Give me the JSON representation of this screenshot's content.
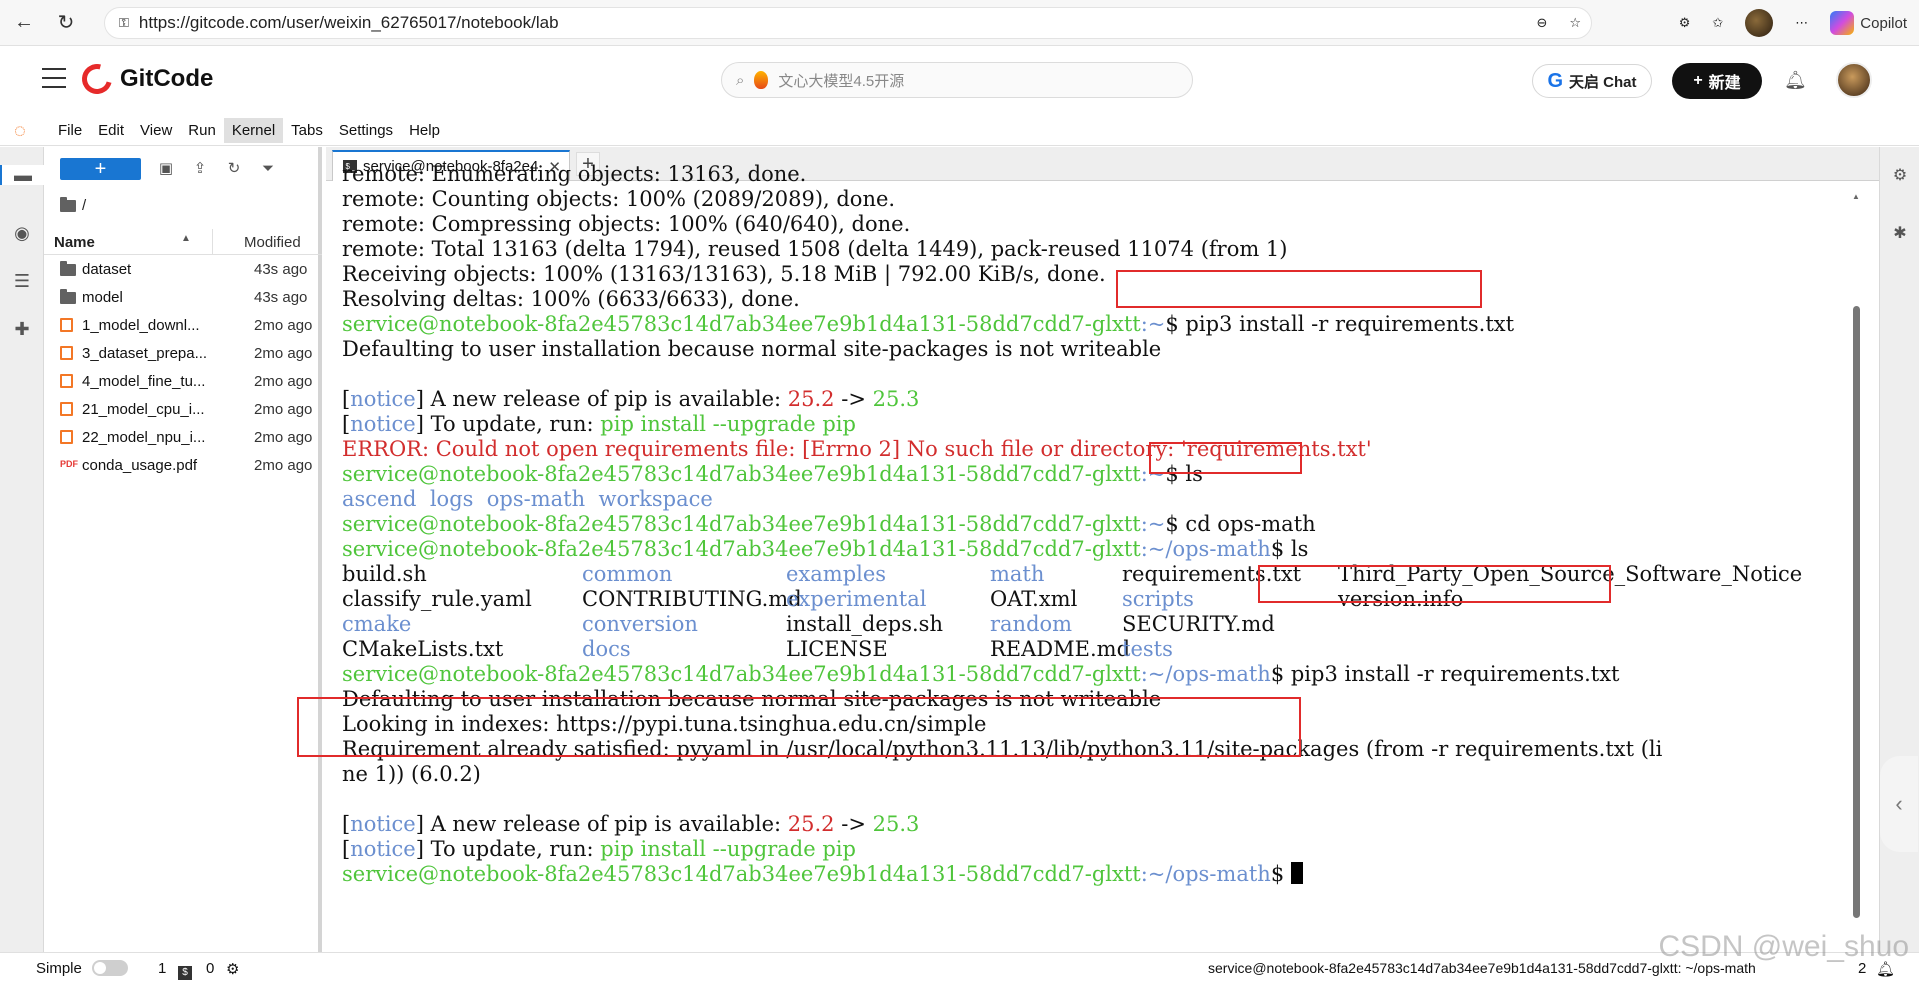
{
  "browser": {
    "url": "https://gitcode.com/user/weixin_62765017/notebook/lab",
    "copilot_label": "Copilot"
  },
  "gitcode": {
    "logo_text": "GitCode",
    "search_placeholder": "文心大模型4.5开源",
    "chat_label": "天启 Chat",
    "new_label": "新建"
  },
  "menu": [
    "File",
    "Edit",
    "View",
    "Run",
    "Kernel",
    "Tabs",
    "Settings",
    "Help"
  ],
  "file_browser": {
    "path": "/",
    "col_name": "Name",
    "col_modified": "Modified",
    "rows": [
      {
        "name": "dataset",
        "modified": "43s ago",
        "icon": "folder-icon"
      },
      {
        "name": "model",
        "modified": "43s ago",
        "icon": "folder-icon"
      },
      {
        "name": "1_model_downl...",
        "modified": "2mo ago",
        "icon": "notebook-icon"
      },
      {
        "name": "3_dataset_prepa...",
        "modified": "2mo ago",
        "icon": "notebook-icon"
      },
      {
        "name": "4_model_fine_tu...",
        "modified": "2mo ago",
        "icon": "notebook-icon"
      },
      {
        "name": "21_model_cpu_i...",
        "modified": "2mo ago",
        "icon": "notebook-icon"
      },
      {
        "name": "22_model_npu_i...",
        "modified": "2mo ago",
        "icon": "notebook-icon"
      },
      {
        "name": "conda_usage.pdf",
        "modified": "2mo ago",
        "icon": "pdf-icon"
      }
    ]
  },
  "tab": {
    "title": "service@notebook-8fa2e4"
  },
  "terminal": {
    "prompt_user": "service@notebook-8fa2e45783c14d7ab34ee7e9b1d4a131-58dd7cdd7-glxtt",
    "l1": "remote: Enumerating objects: 13163, done.",
    "l2": "remote: Counting objects: 100% (2089/2089), done.",
    "l3": "remote: Compressing objects: 100% (640/640), done.",
    "l4": "remote: Total 13163 (delta 1794), reused 1508 (delta 1449), pack-reused 11074 (from 1)",
    "l5": "Receiving objects: 100% (13163/13163), 5.18 MiB | 792.00 KiB/s, done.",
    "l6": "Resolving deltas: 100% (6633/6633), done.",
    "home_sep": ":~",
    "cmd1": "$ pip3 install -r requirements.txt",
    "defaulting": "Defaulting to user installation because normal site-packages is not writeable",
    "notice": "notice",
    "notice_release": "] A new release of pip is available: ",
    "ver_old": "25.2",
    "arrow": " -> ",
    "ver_new": "25.3",
    "notice_update": "] To update, run: ",
    "upgrade_cmd": "pip install --upgrade pip",
    "error": "ERROR: Could not open requirements file: [Errno 2] No such file or directory: 'requirements.txt'",
    "cmd_ls": "$ ls",
    "dirs1": [
      "ascend",
      "logs",
      "ops-math",
      "workspace"
    ],
    "cmd_cd": "$ cd ops-math",
    "opsmath_sep": ":~/ops-math",
    "ls_grid": [
      [
        "build.sh",
        "common",
        "examples",
        "math",
        "requirements.txt",
        "Third_Party_Open_Source_Software_Notice"
      ],
      [
        "classify_rule.yaml",
        "CONTRIBUTING.md",
        "experimental",
        "OAT.xml",
        "scripts",
        "version.info"
      ],
      [
        "cmake",
        "conversion",
        "install_deps.sh",
        "random",
        "SECURITY.md",
        ""
      ],
      [
        "CMakeLists.txt",
        "docs",
        "LICENSE",
        "README.md",
        "tests",
        ""
      ]
    ],
    "ls_blue": [
      [
        false,
        true,
        true,
        true,
        false,
        false
      ],
      [
        false,
        false,
        true,
        false,
        true,
        false
      ],
      [
        true,
        true,
        false,
        true,
        false,
        false
      ],
      [
        false,
        true,
        false,
        false,
        true,
        false
      ]
    ],
    "cmd2": "$ pip3 install -r requirements.txt",
    "looking": "Looking in indexes: https://pypi.tuna.tsinghua.edu.cn/simple",
    "already": "Requirement already satisfied: pyyaml in /usr/local/python3.11.13/lib/python3.11/site-packages (from -r requirements.txt (li",
    "already2": "ne 1)) (6.0.2)",
    "prompt_end": "$ "
  },
  "status": {
    "mode": "Simple",
    "count1": "1",
    "count2": "0",
    "right_text": "service@notebook-8fa2e45783c14d7ab34ee7e9b1d4a131-58dd7cdd7-glxtt: ~/ops-math",
    "right_num": "2"
  },
  "watermark": "CSDN @wei_shuo"
}
